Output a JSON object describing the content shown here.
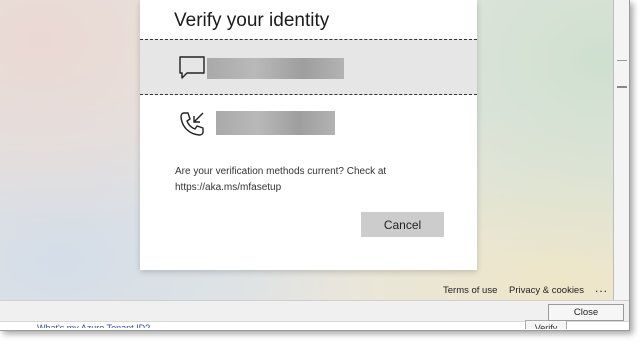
{
  "dialog": {
    "title": "Verify your identity",
    "methods": [
      {
        "type": "text-message",
        "icon": "chat-bubble-icon",
        "selected": true
      },
      {
        "type": "phone-call",
        "icon": "phone-incoming-icon",
        "selected": false
      }
    ],
    "info_line1": "Are your verification methods current? Check at",
    "info_line2": "https://aka.ms/mfasetup",
    "cancel_label": "Cancel"
  },
  "footer": {
    "terms": "Terms of use",
    "privacy": "Privacy & cookies",
    "more": "..."
  },
  "window": {
    "partial_link": "What's my Azure Tenant ID?",
    "partial_button": "Verify",
    "close_label": "Close"
  },
  "colors": {
    "selected_row": "#e6e6e6",
    "cancel_button": "#cccccc",
    "link": "#2b4ea2"
  }
}
